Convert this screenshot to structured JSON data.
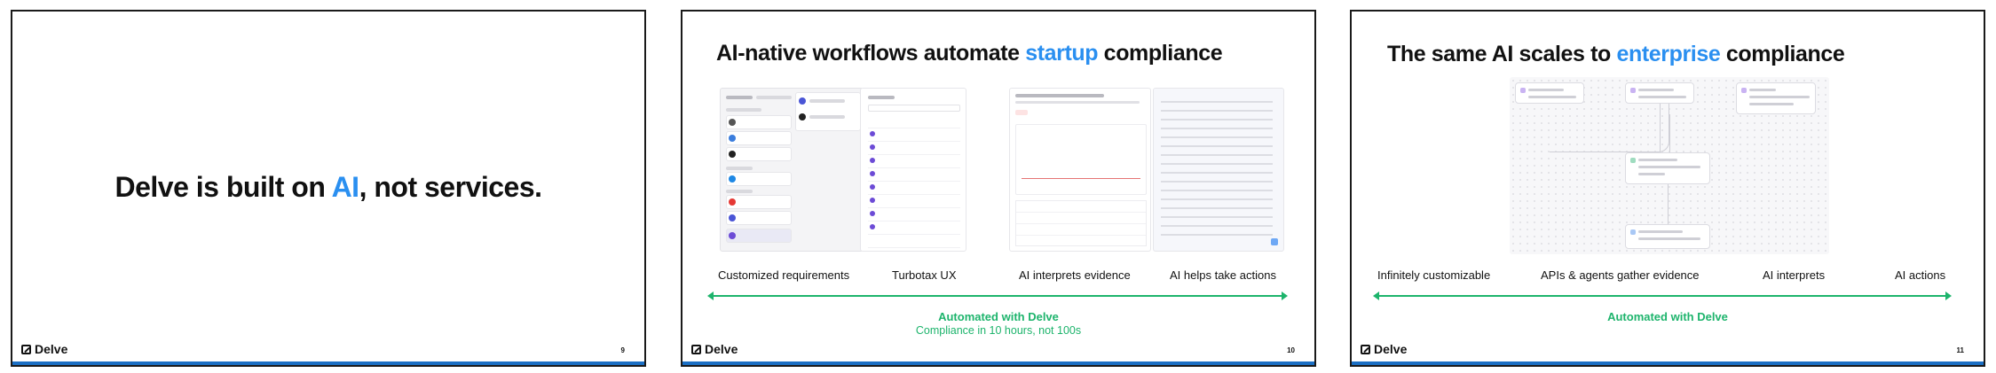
{
  "brand": {
    "name": "Delve"
  },
  "slides": [
    {
      "headline_prefix": "Delve is built on ",
      "headline_accent": "AI",
      "headline_suffix": ", not services.",
      "page_number": "9"
    },
    {
      "title_prefix": "AI-native workflows automate ",
      "title_accent": "startup",
      "title_suffix": " compliance",
      "captions": [
        "Customized requirements",
        "Turbotax UX",
        "AI interprets evidence",
        "AI helps take actions"
      ],
      "automated_label": "Automated with Delve",
      "automated_sub": "Compliance in 10 hours, not 100s",
      "page_number": "10"
    },
    {
      "title_prefix": "The same AI scales to ",
      "title_accent": "enterprise",
      "title_suffix": " compliance",
      "captions": [
        "Infinitely customizable",
        "APIs & agents gather evidence",
        "AI interprets",
        "AI actions"
      ],
      "automated_label": "Automated with Delve",
      "page_number": "11"
    }
  ],
  "colors": {
    "accent": "#2a8ff0",
    "automation_green": "#1db46c",
    "bottom_bar": "#1b6fc4"
  }
}
